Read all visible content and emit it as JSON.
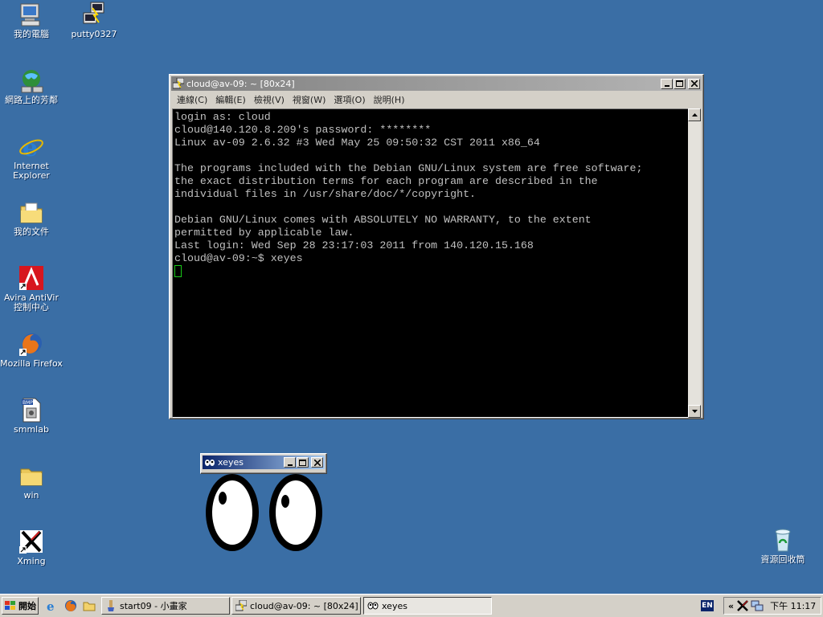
{
  "desktop": {
    "icons": [
      {
        "label": "我的電腦",
        "icon": "my-computer-icon"
      },
      {
        "label": "putty0327",
        "icon": "putty-icon"
      },
      {
        "label": "網路上的芳鄰",
        "icon": "network-places-icon"
      },
      {
        "label": "Internet\nExplorer",
        "icon": "internet-explorer-icon"
      },
      {
        "label": "我的文件",
        "icon": "my-documents-icon"
      },
      {
        "label": "Avira AntiVir\n控制中心",
        "icon": "avira-icon"
      },
      {
        "label": "Mozilla Firefox",
        "icon": "firefox-icon"
      },
      {
        "label": "smmlab",
        "icon": "bitmap-file-icon"
      },
      {
        "label": "win",
        "icon": "folder-icon"
      },
      {
        "label": "Xming",
        "icon": "xming-icon"
      },
      {
        "label": "資源回收筒",
        "icon": "recycle-bin-icon"
      }
    ]
  },
  "putty_window": {
    "title": "cloud@av-09: ~ [80x24]",
    "menu": [
      "連線(C)",
      "編輯(E)",
      "檢視(V)",
      "視窗(W)",
      "選項(O)",
      "說明(H)"
    ],
    "terminal_lines": [
      "login as: cloud",
      "cloud@140.120.8.209's password: ********",
      "Linux av-09 2.6.32 #3 Wed May 25 09:50:32 CST 2011 x86_64",
      "",
      "The programs included with the Debian GNU/Linux system are free software;",
      "the exact distribution terms for each program are described in the",
      "individual files in /usr/share/doc/*/copyright.",
      "",
      "Debian GNU/Linux comes with ABSOLUTELY NO WARRANTY, to the extent",
      "permitted by applicable law.",
      "Last login: Wed Sep 28 23:17:03 2011 from 140.120.15.168",
      "cloud@av-09:~$ xeyes"
    ]
  },
  "xeyes_window": {
    "title": "xeyes"
  },
  "taskbar": {
    "start_label": "開始",
    "tasks": [
      {
        "label": "start09 - 小畫家",
        "icon": "paint-icon"
      },
      {
        "label": "cloud@av-09: ~ [80x24]",
        "icon": "putty-icon"
      },
      {
        "label": "xeyes",
        "icon": "xeyes-icon"
      }
    ],
    "language": "EN",
    "tray_expand": "«",
    "clock": "下午 11:17"
  },
  "colors": {
    "desktop": "#3a6ea5",
    "active_title": "#0a246a",
    "terminal_bg": "#000000",
    "cursor": "#19c819"
  }
}
